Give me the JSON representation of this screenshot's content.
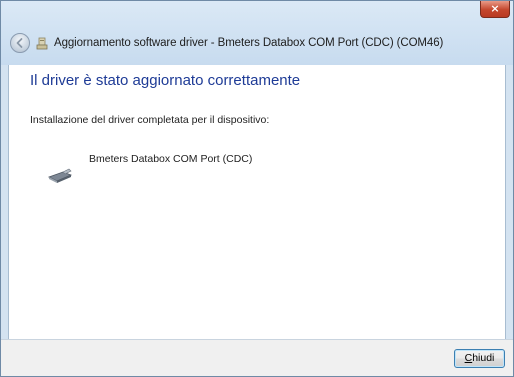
{
  "window": {
    "title": "Aggiornamento software driver - Bmeters Databox COM Port (CDC) (COM46)",
    "close_glyph": "×"
  },
  "content": {
    "heading": "Il driver è stato aggiornato correttamente",
    "subtext": "Installazione del driver completata per il dispositivo:",
    "device_name": "Bmeters Databox COM Port (CDC)"
  },
  "footer": {
    "close_button": {
      "accel": "C",
      "rest": "hiudi"
    }
  },
  "icons": {
    "back": "back-arrow-icon",
    "title": "driver-install-icon",
    "device": "serial-port-device-icon"
  },
  "colors": {
    "heading": "#1e3b96",
    "frame": "#d4e3f1",
    "close_red": "#c4462c"
  }
}
